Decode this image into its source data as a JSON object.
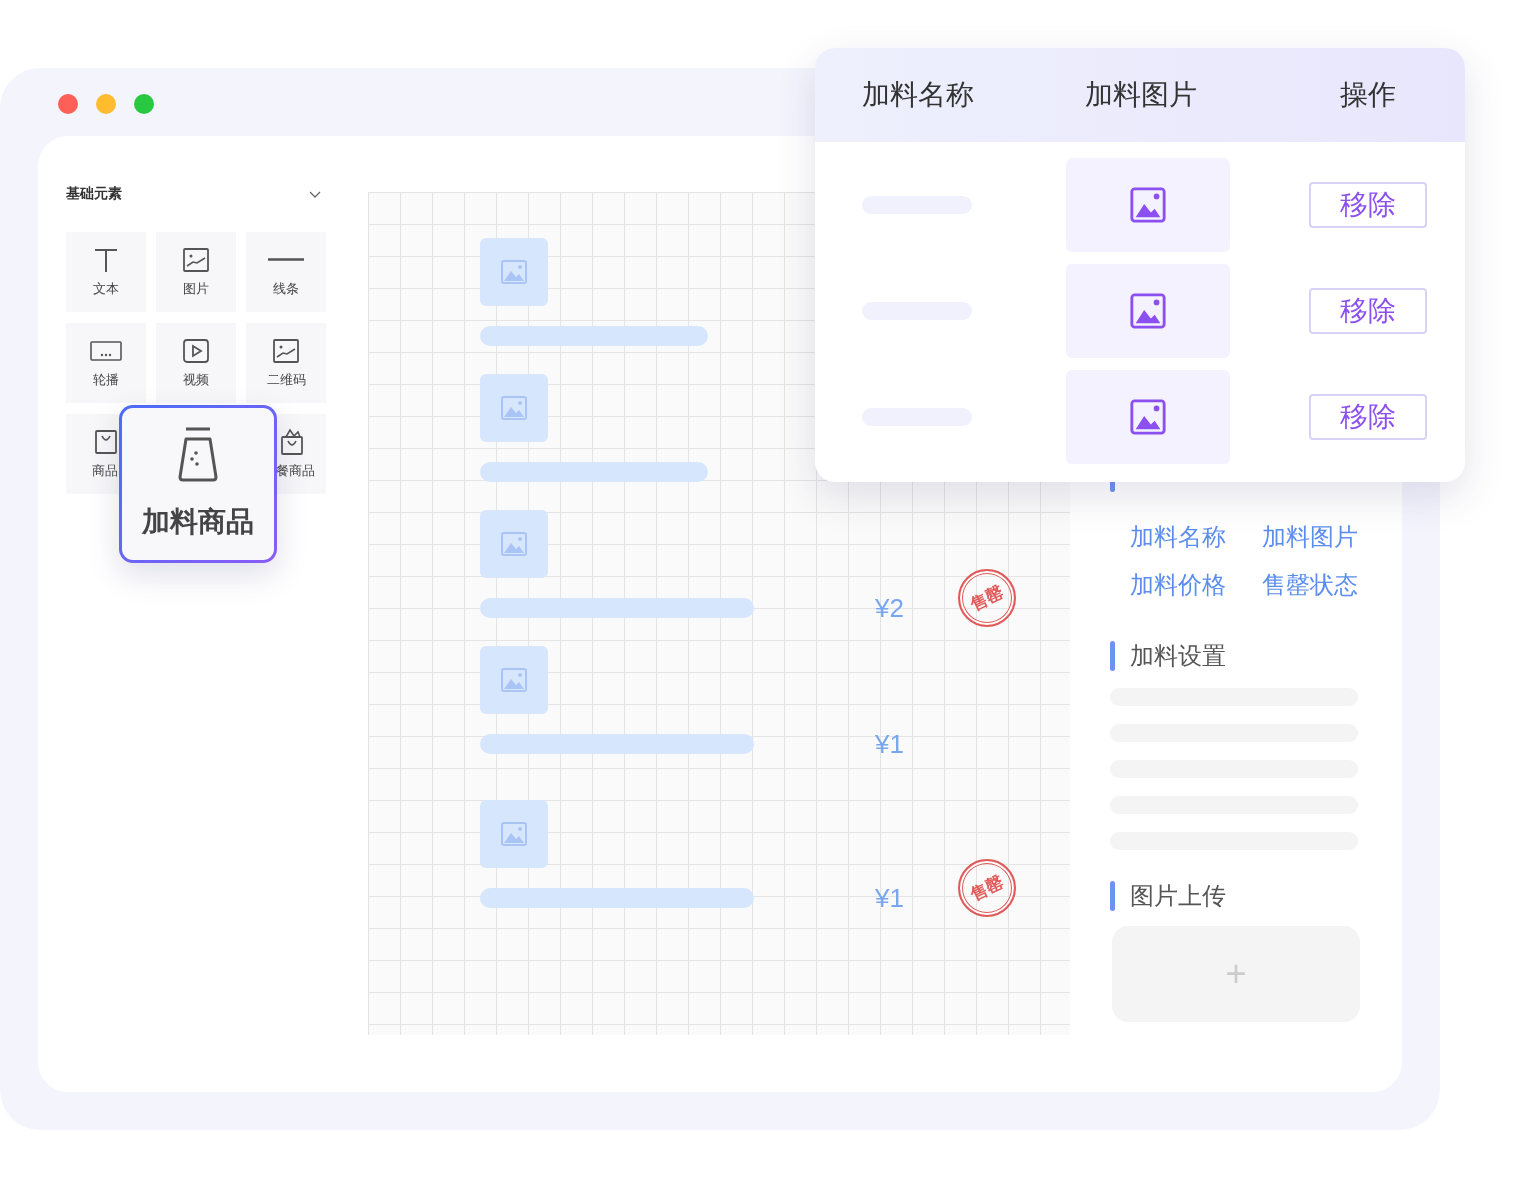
{
  "window": {
    "controls": [
      {
        "color": "#fe5f57"
      },
      {
        "color": "#febc2e"
      },
      {
        "color": "#28c840"
      }
    ]
  },
  "sidebar": {
    "title": "基础元素",
    "expanded": true,
    "tiles": [
      {
        "label": "文本",
        "kind": "text"
      },
      {
        "label": "图片",
        "kind": "image"
      },
      {
        "label": "线条",
        "kind": "line"
      },
      {
        "label": "轮播",
        "kind": "carousel"
      },
      {
        "label": "视频",
        "kind": "video"
      },
      {
        "label": "二维码",
        "kind": "qrcode"
      },
      {
        "label": "商品",
        "kind": "goods"
      },
      {
        "label": "餐商品",
        "kind": "combo"
      }
    ]
  },
  "drag_preview": {
    "label": "加料商品"
  },
  "canvas": {
    "items": [
      {
        "kind": "short"
      },
      {
        "kind": "short"
      },
      {
        "kind": "long",
        "price": "¥2",
        "stamp": "售罄"
      },
      {
        "kind": "long",
        "price": "¥1"
      },
      {
        "kind": "long",
        "price": "¥1",
        "stamp": "售罄"
      }
    ]
  },
  "properties": {
    "fields": [
      "加料名称",
      "加料图片",
      "加料价格",
      "售罄状态"
    ],
    "settings_title": "加料设置",
    "upload_title": "图片上传",
    "upload_button": "+"
  },
  "popup": {
    "columns": [
      "加料名称",
      "加料图片",
      "操作"
    ],
    "rows": [
      {
        "action": "移除"
      },
      {
        "action": "移除"
      },
      {
        "action": "移除"
      }
    ]
  }
}
